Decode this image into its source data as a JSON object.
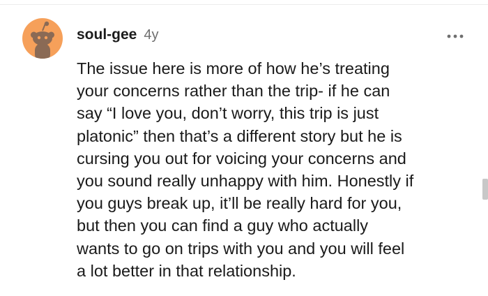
{
  "comment": {
    "avatar_icon": "reddit-snoo-avatar-icon",
    "username": "soul-gee",
    "age": "4y",
    "more_icon": "more-horizontal-icon",
    "body_lines": [
      "The issue here is more of how he’s treating",
      "your concerns rather than the trip- if he can",
      "say “I love you, don’t worry, this trip is just",
      "platonic” then that’s a different story but he is",
      "cursing you out for voicing your concerns and",
      "you sound really unhappy with him. Honestly if",
      "you guys break up, it’ll be really hard for you,",
      "but then you can find a guy who actually",
      "wants to go on trips with you and you will feel",
      "a lot better in that relationship."
    ]
  },
  "colors": {
    "avatar_background": "#f6a05a",
    "snoo_body": "#8a6a55",
    "text": "#1a1a1a",
    "muted_text": "#6f6f6f"
  }
}
